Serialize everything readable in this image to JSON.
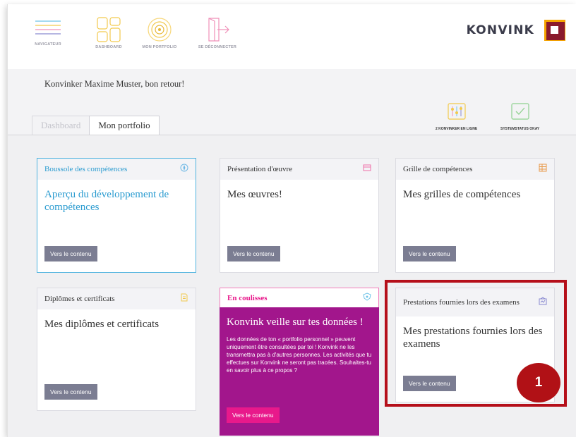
{
  "nav": {
    "items": [
      {
        "label": "NAVIGATEUR",
        "icon": "hamburger-menu-icon"
      },
      {
        "label": "DASHBOARD",
        "icon": "dashboard-grid-icon"
      },
      {
        "label": "MON PORTFOLIO",
        "icon": "portfolio-rings-icon"
      },
      {
        "label": "SE DÉCONNECTER",
        "icon": "logout-door-icon"
      }
    ]
  },
  "logo": {
    "text": "KONVINK"
  },
  "greeting": "Konvinker Maxime Muster, bon retour!",
  "status": {
    "online_label": "2 KONVINKER EN LIGNE",
    "system_label": "SYSTEMSTATUS OKAY"
  },
  "tabs": [
    {
      "label": "Dashboard"
    },
    {
      "label": "Mon portfolio"
    }
  ],
  "cards": [
    {
      "title": "Boussole des compétences",
      "heading": "Aperçu du développement de compétences",
      "button": "Vers le contenu",
      "icon": "compass-icon"
    },
    {
      "title": "Présentation d'œuvre",
      "heading": "Mes œuvres!",
      "button": "Vers le contenu",
      "icon": "presentation-icon"
    },
    {
      "title": "Grille de compétences",
      "heading": "Mes grilles de compétences",
      "button": "Vers le contenu",
      "icon": "grid-icon"
    },
    {
      "title": "Diplômes et certificats",
      "heading": "Mes diplômes et certificats",
      "button": "Vers le contenu",
      "icon": "certificate-icon"
    },
    {
      "title": "En coulisses",
      "heading": "Konvink veille sur tes données !",
      "text": "Les données de ton « portfolio personnel » peuvent uniquement être consultées par toi ! Konvink ne les transmettra pas à d'autres personnes. Les activités que tu effectues sur Konvink ne seront pas tracées. Souhaites-tu en savoir plus à ce propos ?",
      "button": "Vers le contenu",
      "icon": "shield-icon"
    },
    {
      "title": "Prestations fournies lors des examens",
      "heading": "Mes prestations fournies lors des examens",
      "button": "Vers le contenu",
      "icon": "exam-icon"
    }
  ],
  "badge": "1",
  "colors": {
    "accent_blue": "#2a9bd0",
    "accent_pink": "#e8198b",
    "purple": "#a2168c",
    "highlight_red": "#b50f1a",
    "button_gray": "#7b7d92"
  }
}
